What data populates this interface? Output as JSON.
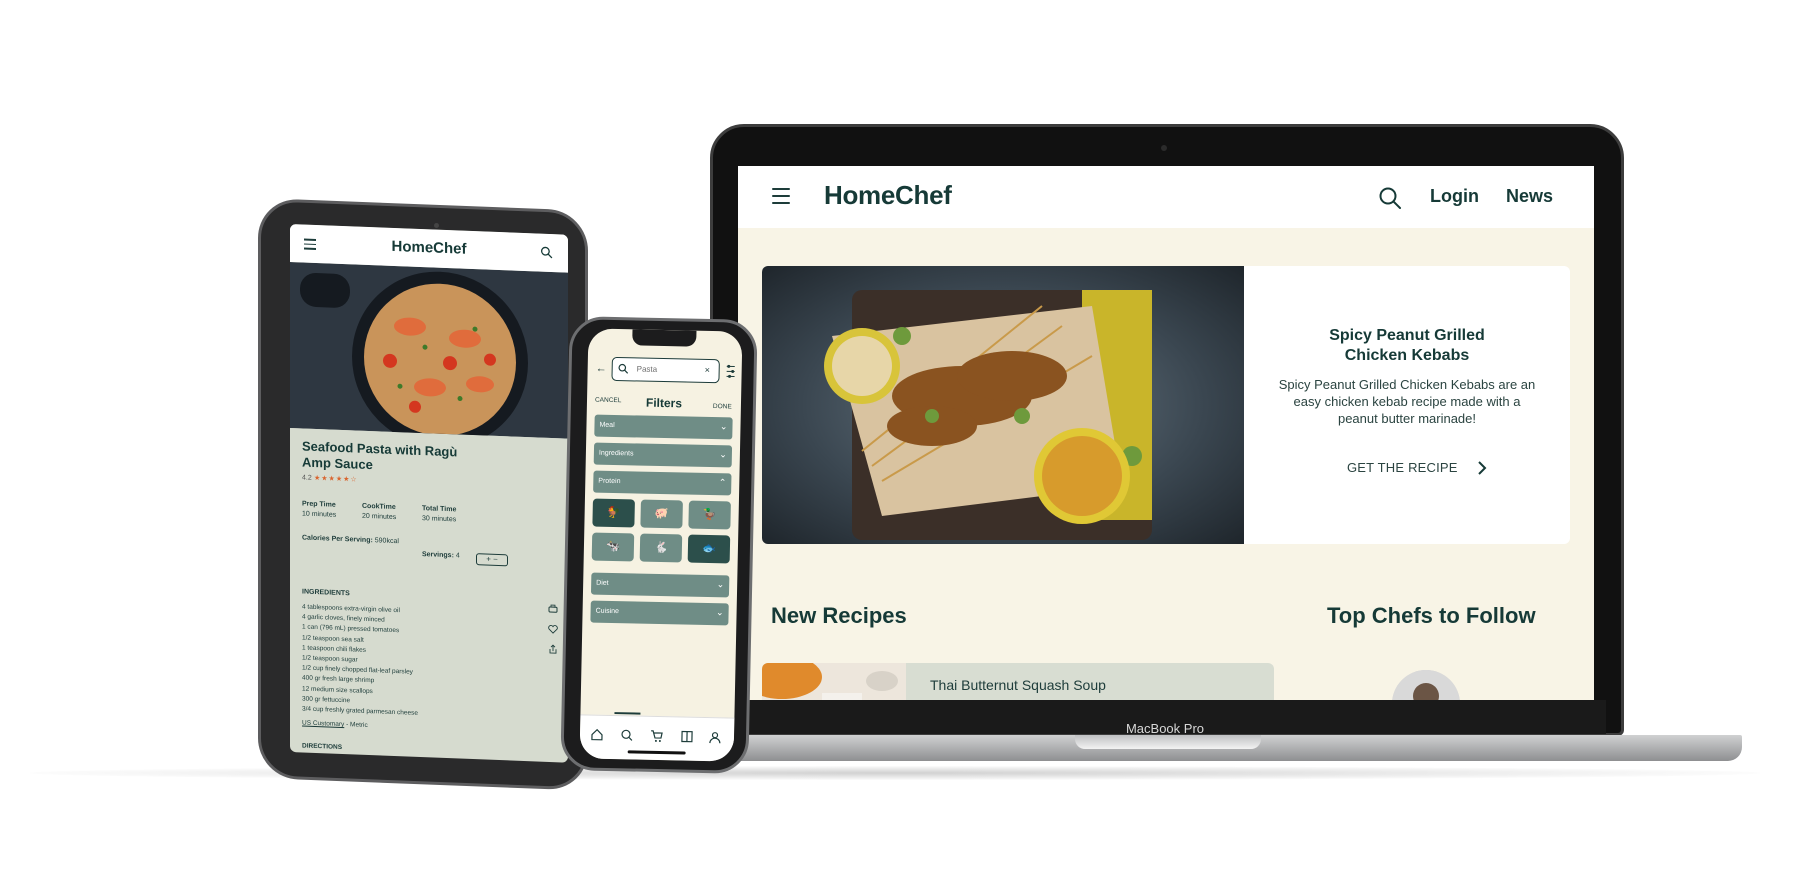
{
  "brand": {
    "name": "HomeChef",
    "primary": "#163a37",
    "cream": "#f8f4e6",
    "sage": "#d6dbcf",
    "button": "#6f8d86",
    "button_active": "#2c4f4b"
  },
  "laptop": {
    "device_label": "MacBook Pro",
    "nav": {
      "logo": "HomeChef",
      "login": "Login",
      "news": "News",
      "menu_icon": "hamburger-icon",
      "search_icon": "search-icon"
    },
    "hero": {
      "title": "Spicy Peanut Grilled Chicken Kebabs",
      "description": "Spicy Peanut Grilled Chicken Kebabs are an easy chicken kebab recipe made with a peanut butter marinade!",
      "cta": "GET THE RECIPE"
    },
    "sections": {
      "new_recipes": "New Recipes",
      "top_chefs": "Top  Chefs to Follow"
    },
    "recipes": [
      {
        "name": "Thai Butternut Squash Soup"
      }
    ]
  },
  "tablet": {
    "logo": "HomeChef",
    "recipe_title": "Seafood Pasta with Ragù Amp Sauce",
    "rating": "4.2",
    "stars": "★★★★★☆",
    "prep": {
      "label": "Prep Time",
      "value": "10 minutes"
    },
    "cook": {
      "label": "CookTime",
      "value": "20 minutes"
    },
    "total": {
      "label": "Total Time",
      "value": "30 minutes"
    },
    "calories": {
      "label": "Calories Per Serving:",
      "value": "590kcal"
    },
    "servings": {
      "label": "Servings:",
      "value": "4"
    },
    "stepper": "+ −",
    "ingredients_title": "INGREDIENTS",
    "ingredients": [
      "4 tablespoons extra-virgin olive oil",
      "4 garlic cloves, finely minced",
      "1 can (796 mL) pressed tomatoes",
      "1/2 teaspoon sea salt",
      "1 teaspoon chili flakes",
      "1/2 teaspoon sugar",
      "1/2 cup finely chopped flat-leaf parsley",
      "400 gr fresh large shrimp",
      "12 medium size scallops",
      "300 gr fettuccine",
      "3/4 cup freshly grated parmesan cheese"
    ],
    "units": {
      "active": "US Customary",
      "separator": " - ",
      "other": "Metric"
    },
    "directions": "DIRECTIONS"
  },
  "phone": {
    "search_value": "Pasta",
    "cancel": "CANCEL",
    "title": "Filters",
    "done": "DONE",
    "dropdowns": {
      "meal": "Meal",
      "ingredients": "Ingredients",
      "protein": "Protein",
      "diet": "Diet",
      "cuisine": "Cuisine"
    },
    "protein_options": [
      {
        "icon": "chicken-icon",
        "glyph": "🐓",
        "active": true
      },
      {
        "icon": "pig-icon",
        "glyph": "🐖",
        "active": false
      },
      {
        "icon": "duck-icon",
        "glyph": "🦆",
        "active": false
      },
      {
        "icon": "cow-icon",
        "glyph": "🐄",
        "active": false
      },
      {
        "icon": "rabbit-icon",
        "glyph": "🐇",
        "active": true
      },
      {
        "icon": "fish-icon",
        "glyph": "🐟",
        "active": true
      }
    ],
    "tabs": [
      "home-icon",
      "search-icon",
      "cart-icon",
      "book-icon",
      "profile-icon"
    ]
  }
}
